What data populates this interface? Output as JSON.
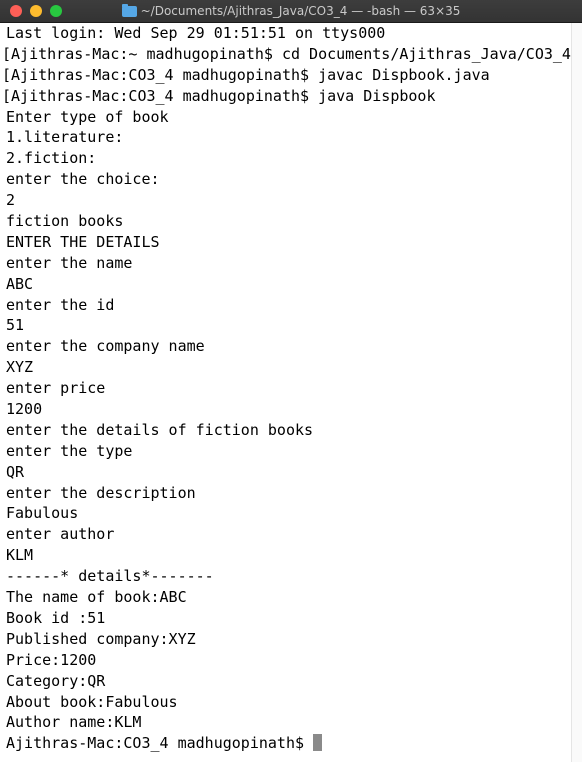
{
  "window": {
    "title": "~/Documents/Ajithras_Java/CO3_4 — -bash — 63×35"
  },
  "terminal": {
    "lines": [
      {
        "text": "Last login: Wed Sep 29 01:51:51 on ttys000",
        "kind": "output"
      },
      {
        "text": "[Ajithras-Mac:~ madhugopinath$ cd Documents/Ajithras_Java/CO3_4",
        "kind": "command"
      },
      {
        "text": "[Ajithras-Mac:CO3_4 madhugopinath$ javac Dispbook.java",
        "kind": "command"
      },
      {
        "text": "[Ajithras-Mac:CO3_4 madhugopinath$ java Dispbook",
        "kind": "command"
      },
      {
        "text": "Enter type of book",
        "kind": "output"
      },
      {
        "text": "1.literature:",
        "kind": "output"
      },
      {
        "text": "2.fiction:",
        "kind": "output"
      },
      {
        "text": "enter the choice:",
        "kind": "output"
      },
      {
        "text": "2",
        "kind": "output"
      },
      {
        "text": "fiction books",
        "kind": "output"
      },
      {
        "text": "ENTER THE DETAILS",
        "kind": "output"
      },
      {
        "text": "enter the name",
        "kind": "output"
      },
      {
        "text": "ABC",
        "kind": "output"
      },
      {
        "text": "enter the id",
        "kind": "output"
      },
      {
        "text": "51",
        "kind": "output"
      },
      {
        "text": "enter the company name",
        "kind": "output"
      },
      {
        "text": "XYZ",
        "kind": "output"
      },
      {
        "text": "enter price",
        "kind": "output"
      },
      {
        "text": "1200",
        "kind": "output"
      },
      {
        "text": "enter the details of fiction books",
        "kind": "output"
      },
      {
        "text": "enter the type",
        "kind": "output"
      },
      {
        "text": "QR",
        "kind": "output"
      },
      {
        "text": "enter the description",
        "kind": "output"
      },
      {
        "text": "Fabulous",
        "kind": "output"
      },
      {
        "text": "enter author",
        "kind": "output"
      },
      {
        "text": "KLM",
        "kind": "output"
      },
      {
        "text": "------* details*-------",
        "kind": "output"
      },
      {
        "text": "The name of book:ABC",
        "kind": "output"
      },
      {
        "text": "Book id :51",
        "kind": "output"
      },
      {
        "text": "Published company:XYZ",
        "kind": "output"
      },
      {
        "text": "Price:1200",
        "kind": "output"
      },
      {
        "text": "Category:QR",
        "kind": "output"
      },
      {
        "text": "About book:Fabulous",
        "kind": "output"
      },
      {
        "text": "Author name:KLM",
        "kind": "output"
      }
    ],
    "prompt": "Ajithras-Mac:CO3_4 madhugopinath$"
  },
  "colors": {
    "titlebar": "#333333",
    "terminal_bg": "#ffffff",
    "text": "#000000",
    "close": "#fe5f57",
    "minimize": "#febc2e",
    "zoom": "#28c840"
  }
}
